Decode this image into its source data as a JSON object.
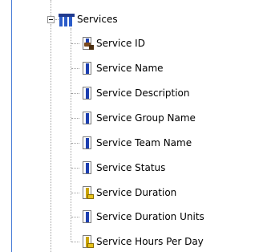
{
  "tree": {
    "root": {
      "label": "Services",
      "icon": "table-icon"
    },
    "children": [
      {
        "label": "Service ID",
        "icon": "key-field-icon"
      },
      {
        "label": "Service Name",
        "icon": "text-field-icon"
      },
      {
        "label": "Service Description",
        "icon": "text-field-icon"
      },
      {
        "label": "Service Group Name",
        "icon": "text-field-icon"
      },
      {
        "label": "Service Team Name",
        "icon": "text-field-icon"
      },
      {
        "label": "Service Status",
        "icon": "text-field-icon"
      },
      {
        "label": "Service Duration",
        "icon": "numeric-field-icon"
      },
      {
        "label": "Service Duration Units",
        "icon": "text-field-icon"
      },
      {
        "label": "Service Hours Per Day",
        "icon": "numeric-field-icon"
      }
    ]
  }
}
